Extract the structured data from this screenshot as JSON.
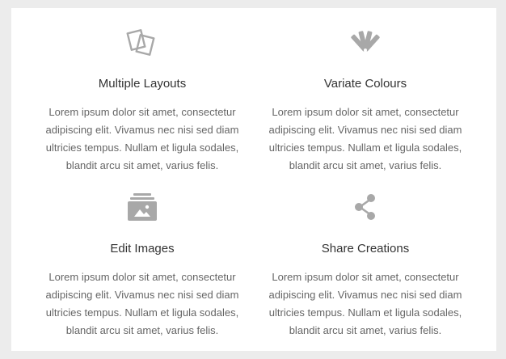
{
  "features": [
    {
      "icon": "layers-icon",
      "title": "Multiple Layouts",
      "description": "Lorem ipsum dolor sit amet, consectetur adipiscing elit. Vivamus nec nisi sed diam ultricies tempus. Nullam et ligula sodales, blandit arcu sit amet, varius felis."
    },
    {
      "icon": "color-swatches-icon",
      "title": "Variate Colours",
      "description": "Lorem ipsum dolor sit amet, consectetur adipiscing elit. Vivamus nec nisi sed diam ultricies tempus. Nullam et ligula sodales, blandit arcu sit amet, varius felis."
    },
    {
      "icon": "image-folder-icon",
      "title": "Edit Images",
      "description": "Lorem ipsum dolor sit amet, consectetur adipiscing elit. Vivamus nec nisi sed diam ultricies tempus. Nullam et ligula sodales, blandit arcu sit amet, varius felis."
    },
    {
      "icon": "share-icon",
      "title": "Share Creations",
      "description": "Lorem ipsum dolor sit amet, consectetur adipiscing elit. Vivamus nec nisi sed diam ultricies tempus. Nullam et ligula sodales, blandit arcu sit amet, varius felis."
    }
  ],
  "colors": {
    "page_background": "#ececec",
    "card_background": "#ffffff",
    "icon": "#a8a8a8",
    "title_text": "#333333",
    "body_text": "#666666"
  }
}
